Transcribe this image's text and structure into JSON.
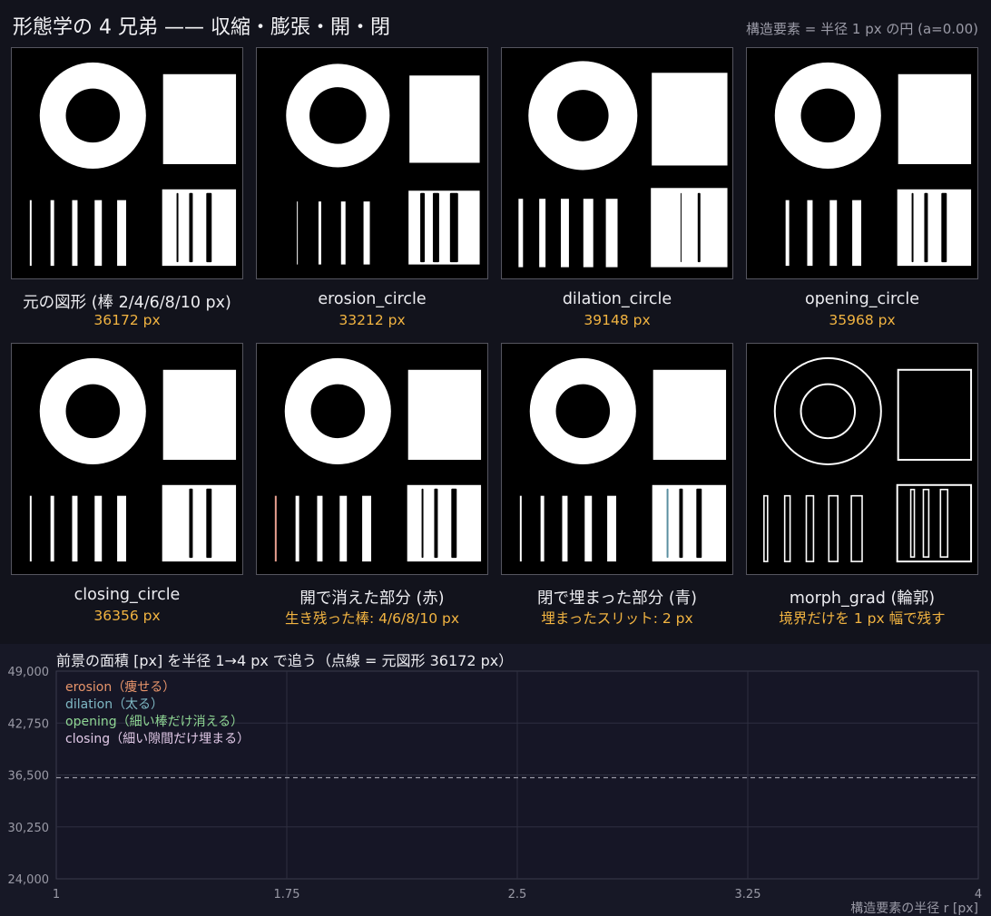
{
  "header": {
    "title": "形態学の 4 兄弟 —— 収縮・膨張・開・閉",
    "subtitle": "構造要素 = 半径 1 px の円 (a=0.00)"
  },
  "panels": [
    {
      "name": "元の図形 (棒 2/4/6/8/10 px)",
      "value": "36172 px",
      "variant": "original"
    },
    {
      "name": "erosion_circle",
      "value": "33212 px",
      "variant": "erosion"
    },
    {
      "name": "dilation_circle",
      "value": "39148 px",
      "variant": "dilation"
    },
    {
      "name": "opening_circle",
      "value": "35968 px",
      "variant": "opening"
    },
    {
      "name": "closing_circle",
      "value": "36356 px",
      "variant": "closing"
    },
    {
      "name": "開で消えた部分 (赤)",
      "value": "生き残った棒: 4/6/8/10 px",
      "variant": "open-diff"
    },
    {
      "name": "閉で埋まった部分 (青)",
      "value": "埋まったスリット: 2 px",
      "variant": "close-diff"
    },
    {
      "name": "morph_grad (輪郭)",
      "value": "境界だけを 1 px 幅で残す",
      "variant": "gradient"
    }
  ],
  "colors": {
    "value_text": "#f2b441",
    "erosion": "#e8956b",
    "dilation": "#7fb8c4",
    "opening": "#8fd694",
    "closing": "#e0c8e6",
    "removed_red": "#e8a090",
    "filled_blue": "#5a8fa0"
  },
  "chart_data": {
    "type": "line",
    "title": "前景の面積 [px] を半径 1→4 px で追う（点線 = 元図形 36172 px）",
    "xlabel": "構造要素の半径 r [px]",
    "ylabel": "",
    "xlim": [
      1,
      4
    ],
    "ylim": [
      24000,
      49000
    ],
    "x_ticks": [
      "1",
      "1.75",
      "2.5",
      "3.25",
      "4"
    ],
    "y_ticks": [
      "49,000",
      "42,750",
      "36,500",
      "30,250",
      "24,000"
    ],
    "reference_line": 36172,
    "grid": true,
    "legend_position": "top-left",
    "series": [
      {
        "name": "erosion（痩せる）",
        "values": []
      },
      {
        "name": "dilation（太る）",
        "values": []
      },
      {
        "name": "opening（細い棒だけ消える）",
        "values": []
      },
      {
        "name": "closing（細い隙間だけ埋まる）",
        "values": []
      }
    ]
  }
}
